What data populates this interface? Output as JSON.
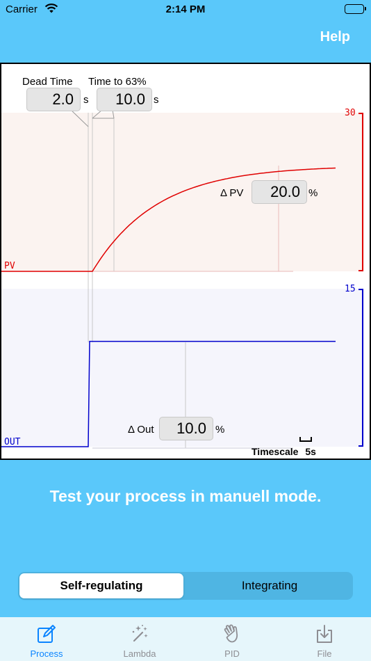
{
  "status_bar": {
    "carrier": "Carrier",
    "time": "2:14 PM"
  },
  "header": {
    "help_label": "Help"
  },
  "chart": {
    "dead_time": {
      "label": "Dead Time",
      "value": "2.0",
      "unit": "s"
    },
    "time_to_63": {
      "label": "Time to 63%",
      "value": "10.0",
      "unit": "s"
    },
    "delta_pv": {
      "label": "Δ PV",
      "value": "20.0",
      "unit": "%"
    },
    "delta_out": {
      "label": "Δ Out",
      "value": "10.0",
      "unit": "%"
    },
    "pv_label": "PV",
    "out_label": "OUT",
    "pv_max": "30",
    "out_max": "15",
    "timescale_label": "Timescale",
    "timescale_value": "5s"
  },
  "message": "Test your process in manuell mode.",
  "mode_selector": {
    "options": [
      "Self-regulating",
      "Integrating"
    ],
    "selected": "Self-regulating"
  },
  "tabs": [
    {
      "label": "Process",
      "icon": "pencil-square-icon",
      "active": true
    },
    {
      "label": "Lambda",
      "icon": "magic-wand-icon",
      "active": false
    },
    {
      "label": "PID",
      "icon": "hand-wave-icon",
      "active": false
    },
    {
      "label": "File",
      "icon": "download-tray-icon",
      "active": false
    }
  ],
  "chart_data": {
    "type": "line",
    "series": [
      {
        "name": "PV",
        "x": [
          0,
          2,
          5,
          10,
          15,
          20,
          25,
          30
        ],
        "y": [
          0,
          0,
          5.2,
          12.6,
          16.6,
          18.5,
          19.5,
          19.9
        ]
      },
      {
        "name": "OUT",
        "x": [
          0,
          2,
          2,
          30
        ],
        "y": [
          0,
          0,
          10,
          10
        ]
      }
    ],
    "colors": {
      "pv": "#e00000",
      "out": "#0000cc"
    }
  }
}
